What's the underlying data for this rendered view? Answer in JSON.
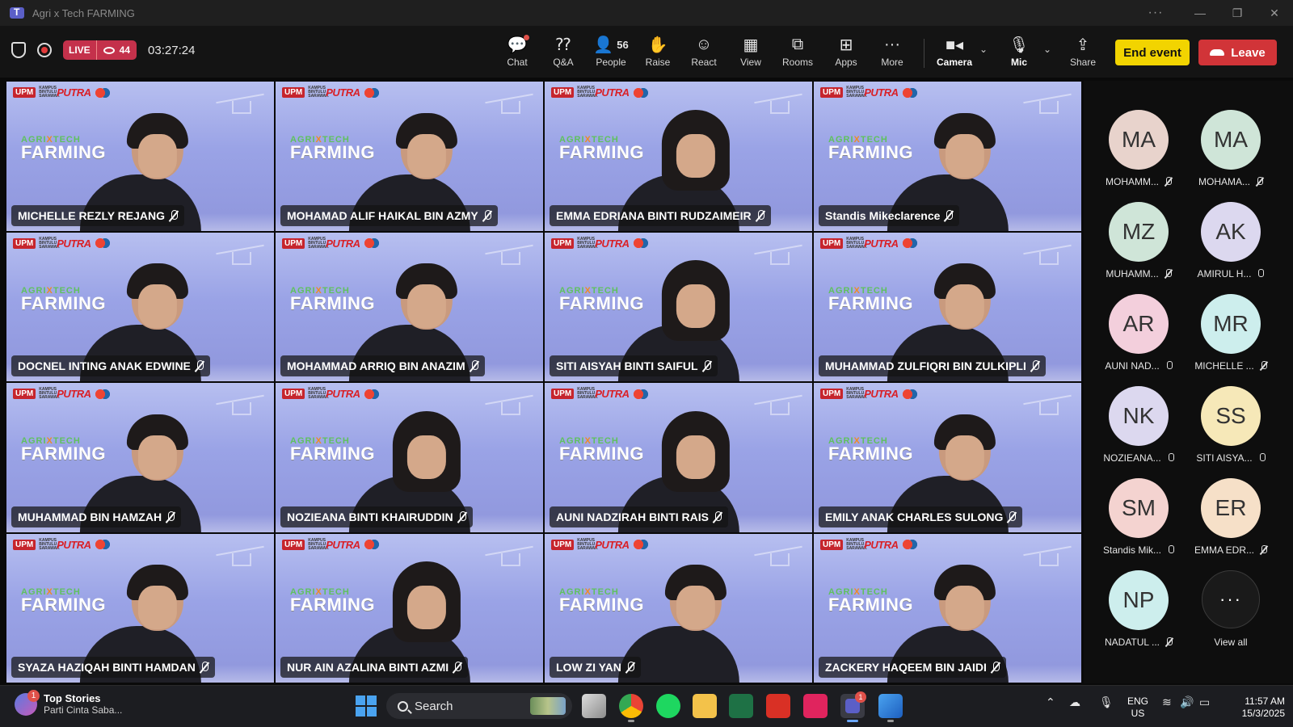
{
  "window": {
    "title": "Agri x Tech FARMING"
  },
  "toolbar": {
    "live_label": "LIVE",
    "viewer_count": "44",
    "timer": "03:27:24",
    "buttons": [
      {
        "label": "Chat",
        "icon": "chat-icon"
      },
      {
        "label": "Q&A",
        "icon": "qa-icon"
      },
      {
        "label": "People",
        "icon": "people-icon",
        "count": "56"
      },
      {
        "label": "Raise",
        "icon": "hand-icon"
      },
      {
        "label": "React",
        "icon": "smiley-icon"
      },
      {
        "label": "View",
        "icon": "grid-icon"
      },
      {
        "label": "Rooms",
        "icon": "rooms-icon"
      },
      {
        "label": "Apps",
        "icon": "plus-icon"
      },
      {
        "label": "More",
        "icon": "ellipsis-icon"
      },
      {
        "label": "Camera",
        "icon": "camera-icon"
      },
      {
        "label": "Mic",
        "icon": "mic-off-icon"
      },
      {
        "label": "Share",
        "icon": "share-icon"
      }
    ],
    "end_event_label": "End event",
    "leave_label": "Leave",
    "accent_end": "#f2d400",
    "accent_leave": "#d13438"
  },
  "tiles": [
    {
      "name": "MICHELLE REZLY REJANG"
    },
    {
      "name": "MOHAMAD ALIF HAIKAL BIN AZMY"
    },
    {
      "name": "EMMA EDRIANA BINTI RUDZAIMEIR"
    },
    {
      "name": "Standis Mikeclarence"
    },
    {
      "name": "DOCNEL INTING ANAK EDWINE"
    },
    {
      "name": "MOHAMMAD ARRIQ BIN ANAZIM"
    },
    {
      "name": "SITI AISYAH BINTI SAIFUL"
    },
    {
      "name": "MUHAMMAD ZULFIQRI BIN ZULKIPLI"
    },
    {
      "name": "MUHAMMAD BIN HAMZAH"
    },
    {
      "name": "NOZIEANA BINTI KHAIRUDDIN"
    },
    {
      "name": "AUNI NADZIRAH BINTI RAIS"
    },
    {
      "name": "EMILY ANAK CHARLES SULONG"
    },
    {
      "name": "SYAZA HAZIQAH BINTI HAMDAN"
    },
    {
      "name": "NUR AIN AZALINA BINTI AZMI"
    },
    {
      "name": "LOW ZI YAN"
    },
    {
      "name": "ZACKERY HAQEEM BIN JAIDI"
    }
  ],
  "tile_branding": {
    "upm": "UPM",
    "small": "KAMPUS BINTULU SARAWAK",
    "putra": "PUTRA",
    "sulam": "SULAM",
    "agri": "AGRI",
    "x": "X",
    "tech": "TECH",
    "farming": "FARMING"
  },
  "side_gallery": [
    {
      "initials": "MA",
      "name": "MOHAMM...",
      "color": "#e8d3cc",
      "mic": "off"
    },
    {
      "initials": "MA",
      "name": "MOHAMA...",
      "color": "#cfe5d8",
      "mic": "off"
    },
    {
      "initials": "MZ",
      "name": "MUHAMM...",
      "color": "#cfe5d8",
      "mic": "off"
    },
    {
      "initials": "AK",
      "name": "AMIRUL H...",
      "color": "#dcd8ef",
      "mic": "on"
    },
    {
      "initials": "AR",
      "name": "AUNI NAD...",
      "color": "#f3cfdc",
      "mic": "on"
    },
    {
      "initials": "MR",
      "name": "MICHELLE ...",
      "color": "#cdeeed",
      "mic": "off"
    },
    {
      "initials": "NK",
      "name": "NOZIEANA...",
      "color": "#dcd8ef",
      "mic": "on"
    },
    {
      "initials": "SS",
      "name": "SITI AISYA...",
      "color": "#f6e8b8",
      "mic": "on"
    },
    {
      "initials": "SM",
      "name": "Standis Mik...",
      "color": "#f4d3d0",
      "mic": "on"
    },
    {
      "initials": "ER",
      "name": "EMMA EDR...",
      "color": "#f6e0c8",
      "mic": "off"
    },
    {
      "initials": "NP",
      "name": "NADATUL ...",
      "color": "#cdeeed",
      "mic": "off"
    }
  ],
  "view_all_label": "View all",
  "taskbar": {
    "news_badge": "1",
    "news_title": "Top Stories",
    "news_sub": "Parti Cinta Saba...",
    "search_label": "Search",
    "teams_badge": "1",
    "lang_top": "ENG",
    "lang_bottom": "US",
    "time": "11:57 AM",
    "date": "15/3/2025"
  }
}
